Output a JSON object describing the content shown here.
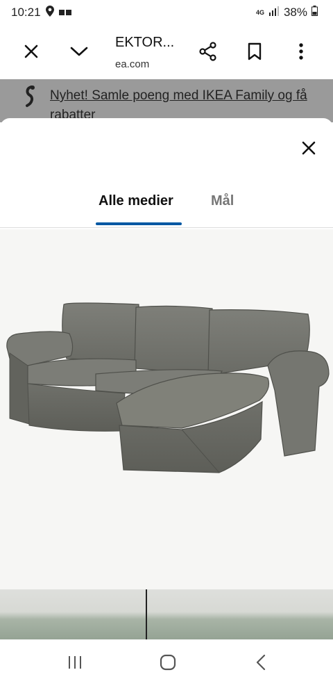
{
  "status": {
    "time": "10:21",
    "network": "4G",
    "battery": "38%"
  },
  "browser": {
    "title": "EKTOR...",
    "url": "ea.com"
  },
  "promo": {
    "text": "Nyhet! Samle poeng med IKEA Family og få rabatter"
  },
  "media_tabs": [
    {
      "label": "Alle medier",
      "active": true
    },
    {
      "label": "Mål",
      "active": false
    }
  ],
  "icons": {
    "close_browser": "close-icon",
    "collapse": "chevron-down-icon",
    "share": "share-icon",
    "bookmark": "bookmark-icon",
    "more": "more-vert-icon",
    "promo": "ikea-family-icon",
    "sheet_close": "close-icon",
    "nav_recents": "recents-icon",
    "nav_home": "home-icon",
    "nav_back": "back-icon"
  },
  "colors": {
    "accent": "#0058a3",
    "promo_bg": "#9a9a9a",
    "sofa": "#6e6f69"
  }
}
